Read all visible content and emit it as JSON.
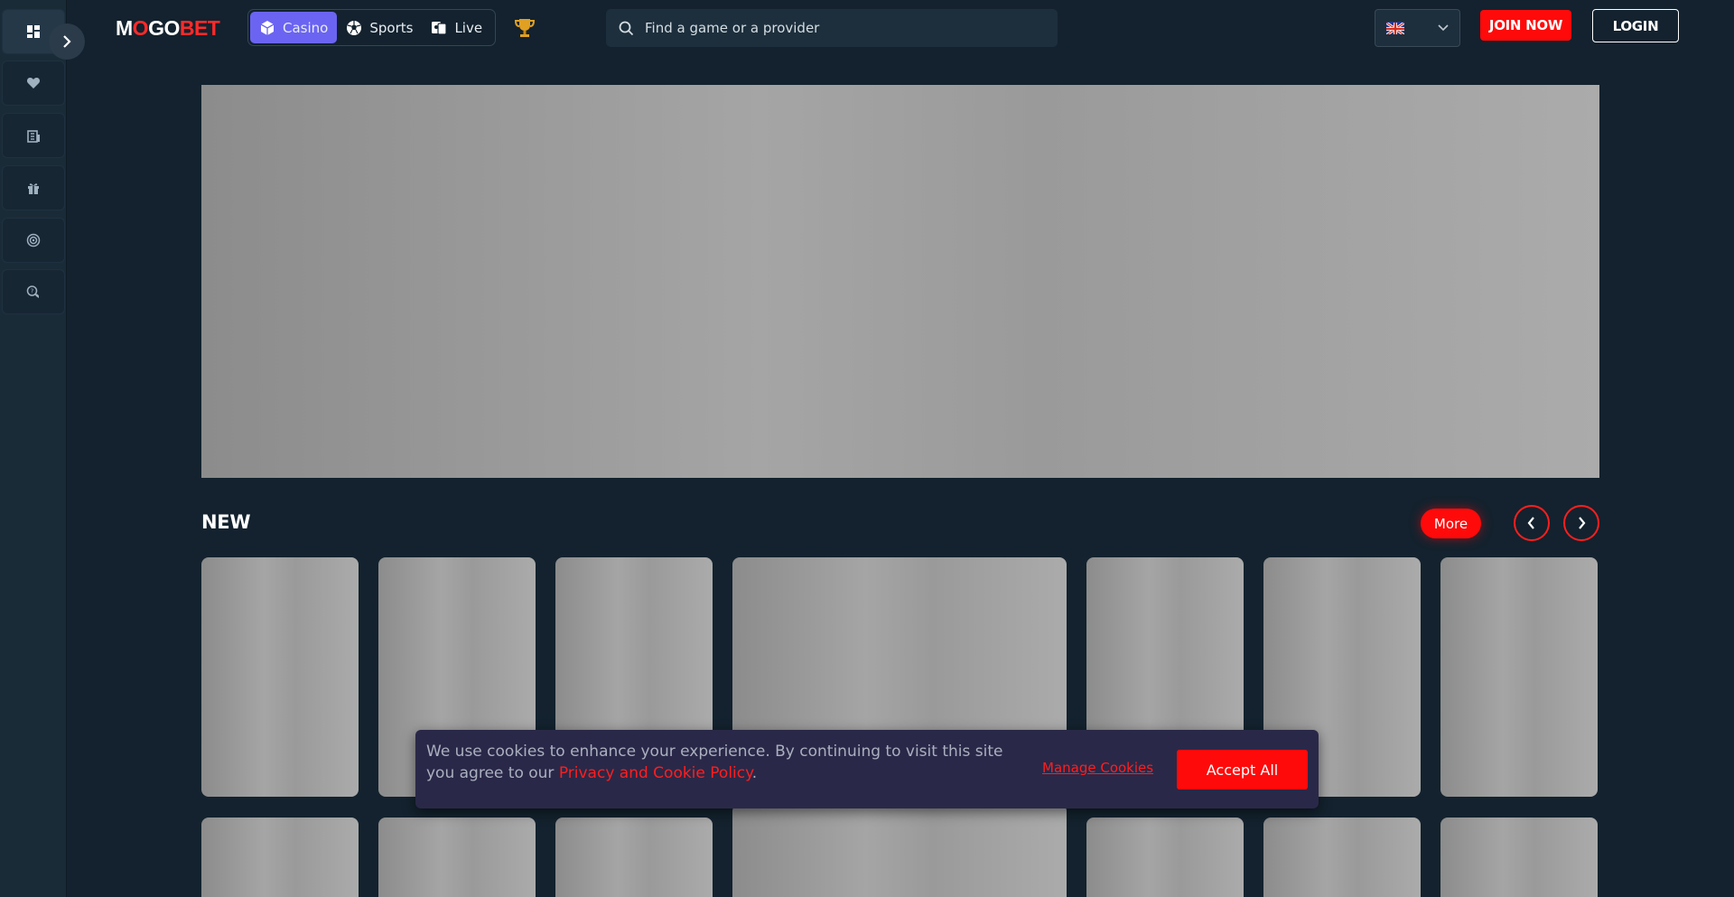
{
  "brand": {
    "logo_parts": [
      {
        "text": "M",
        "color": "#ffffff"
      },
      {
        "text": "O",
        "color": "#ff2a2a"
      },
      {
        "text": "GO",
        "color": "#ffffff"
      },
      {
        "text": "BET",
        "color": "#ff2a2a"
      }
    ]
  },
  "sidebar": {
    "items": [
      {
        "icon": "dashboard-icon",
        "active": true
      },
      {
        "icon": "heart-icon",
        "active": false
      },
      {
        "icon": "building-icon",
        "active": false
      },
      {
        "icon": "gift-icon",
        "active": false
      },
      {
        "icon": "target-icon",
        "active": false
      },
      {
        "icon": "chat-icon",
        "active": false
      }
    ],
    "expand_icon": "chevron-right-icon"
  },
  "header": {
    "tabs": [
      {
        "label": "Casino",
        "icon": "cube-icon",
        "active": true
      },
      {
        "label": "Sports",
        "icon": "soccer-ball-icon",
        "active": false
      },
      {
        "label": "Live",
        "icon": "cards-icon",
        "active": false
      }
    ],
    "trophy_icon": "trophy-icon",
    "search": {
      "placeholder": "Find a game or a provider",
      "value": ""
    },
    "language": {
      "flag": "uk-flag-icon"
    },
    "join_label": "JOIN NOW",
    "login_label": "LOGIN"
  },
  "section": {
    "title": "NEW",
    "more_label": "More"
  },
  "cookie": {
    "text_before": "We use cookies to enhance your experience. By continuing to visit this site you agree to our ",
    "policy_link": "Privacy and Cookie Policy",
    "text_after": ".",
    "manage_label": "Manage Cookies",
    "accept_label": "Accept All"
  },
  "colors": {
    "background": "#13222e",
    "accent_red": "#ff0a0a",
    "active_tab": "#6b64f2"
  }
}
